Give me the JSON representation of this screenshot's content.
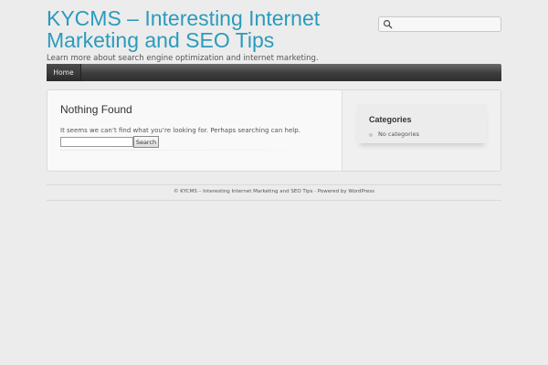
{
  "header": {
    "site_title": "KYCMS – Interesting Internet Marketing and SEO Tips",
    "tagline": "Learn more about search engine optimization and internet marketing.",
    "search_placeholder": "",
    "search_icon": "magnifier-icon"
  },
  "nav": {
    "items": [
      {
        "label": "Home"
      }
    ]
  },
  "main": {
    "title": "Nothing Found",
    "message": "It seems we can’t find what you’re looking for. Perhaps searching can help.",
    "search_value": "",
    "search_button": "Search"
  },
  "sidebar": {
    "widget_title": "Categories",
    "items": [
      {
        "label": "No categories"
      }
    ]
  },
  "footer": {
    "text": "© KYCMS – Interesting Internet Marketing and SEO Tips · Powered by WordPress"
  },
  "colors": {
    "accent": "#2b9bbb",
    "background": "#ececec",
    "nav_bar": "#3c3c3c"
  }
}
